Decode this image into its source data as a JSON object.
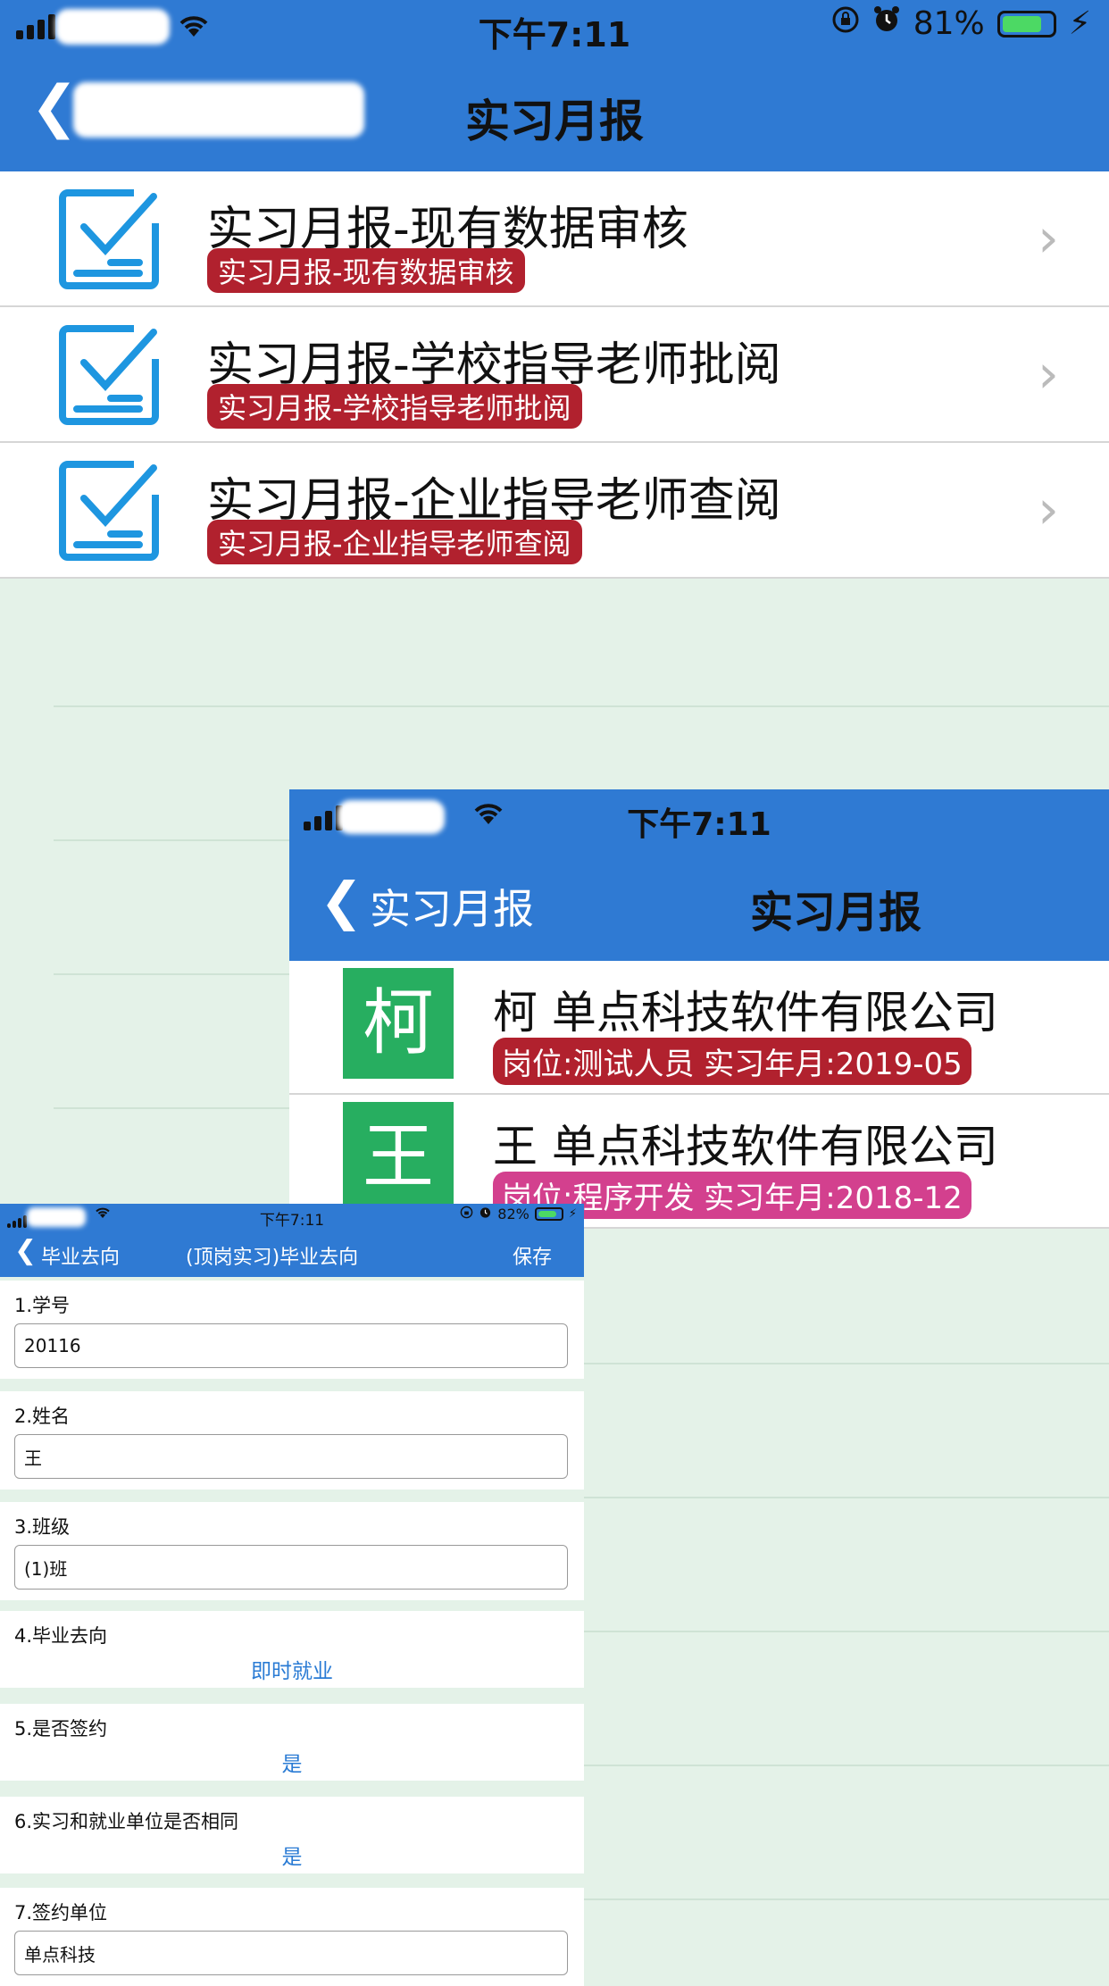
{
  "screen1": {
    "status": {
      "carrier": "",
      "time": "下午7:11",
      "battery": "81%",
      "battery_level": 0.81
    },
    "nav": {
      "back_label": "",
      "title": "实习月报"
    },
    "items": [
      {
        "title": "实习月报-现有数据审核",
        "badge": "实习月报-现有数据审核"
      },
      {
        "title": "实习月报-学校指导老师批阅",
        "badge": "实习月报-学校指导老师批阅"
      },
      {
        "title": "实习月报-企业指导老师查阅",
        "badge": "实习月报-企业指导老师查阅"
      }
    ]
  },
  "screen2": {
    "status": {
      "time": "下午7:11"
    },
    "nav": {
      "back_label": "实习月报",
      "title": "实习月报"
    },
    "items": [
      {
        "avatar": "柯",
        "title": "柯    单点科技软件有限公司",
        "badge": "岗位:测试人员 实习年月:2019-05",
        "badge_color": "#b1212e"
      },
      {
        "avatar": "王",
        "title": "王      单点科技软件有限公司",
        "badge": "岗位:程序开发 实习年月:2018-12",
        "badge_color": "#d3408e"
      }
    ]
  },
  "screen3": {
    "status": {
      "time": "下午7:11",
      "battery": "82%",
      "battery_level": 0.82
    },
    "nav": {
      "back_label": "毕业去向",
      "title": "(顶岗实习)毕业去向",
      "save_label": "保存"
    },
    "fields": [
      {
        "label": "1.学号",
        "value": "20116"
      },
      {
        "label": "2.姓名",
        "value": "王"
      },
      {
        "label": "3.班级",
        "value": "(1)班"
      },
      {
        "label": "4.毕业去向",
        "value": "即时就业"
      },
      {
        "label": "5.是否签约",
        "value": "是"
      },
      {
        "label": "6.实习和就业单位是否相同",
        "value": "是"
      },
      {
        "label": "7.签约单位",
        "value": "单点科技"
      }
    ]
  }
}
